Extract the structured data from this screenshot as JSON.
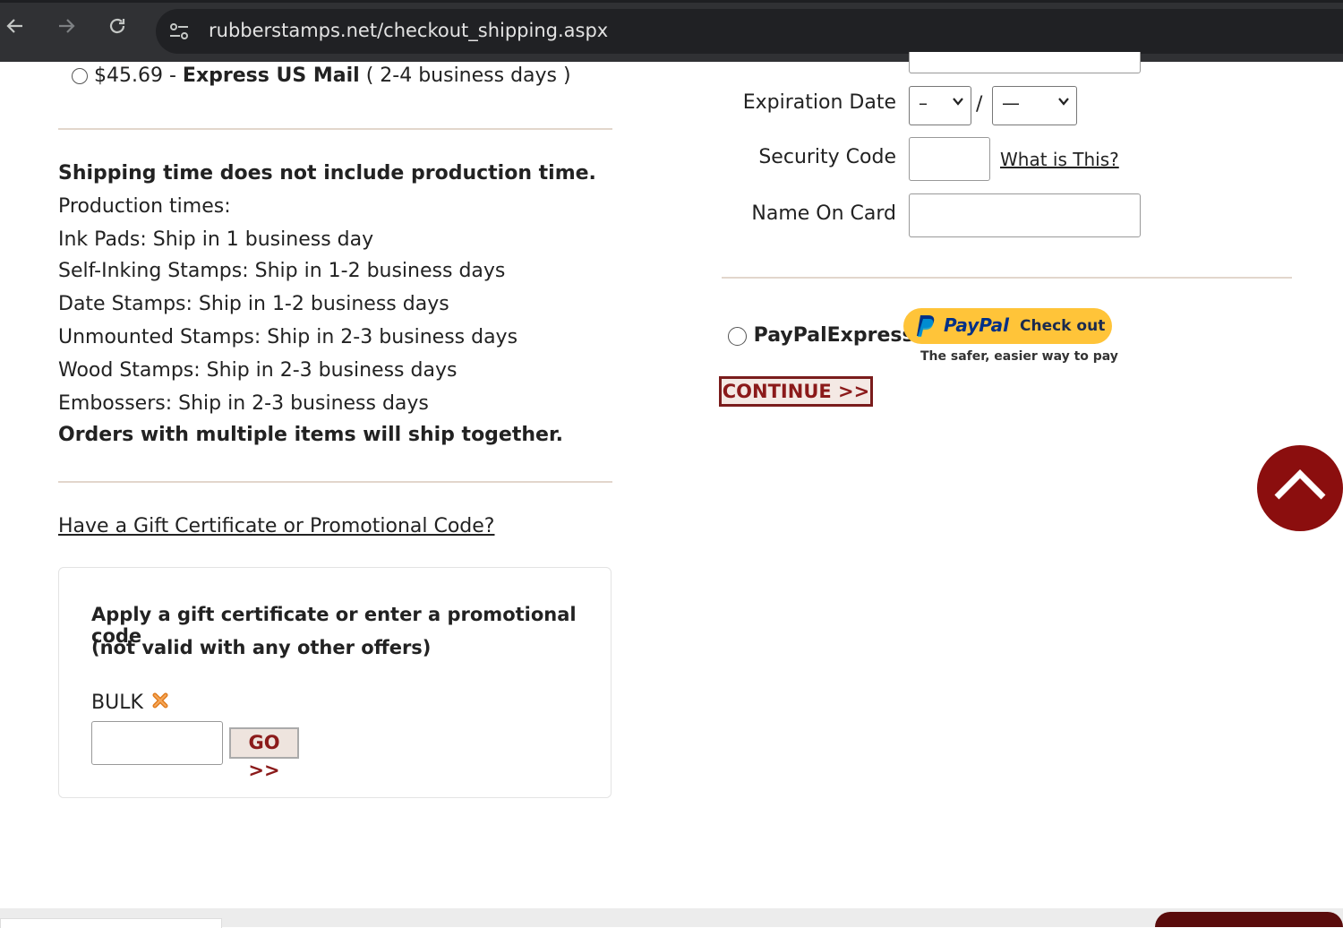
{
  "browser": {
    "url": "rubberstamps.net/checkout_shipping.aspx"
  },
  "shipping": {
    "express_option": {
      "price": "$45.69",
      "separator": " - ",
      "method": "Express US Mail",
      "days": " ( 2-4 business days )"
    },
    "notice_bold": "Shipping time does not include production time.",
    "production_header": "Production times:",
    "production_times": [
      "Ink Pads: Ship in 1 business day",
      "Self-Inking Stamps: Ship in 1-2 business days",
      "Date Stamps: Ship in 1-2 business days",
      "Unmounted Stamps: Ship in 2-3 business days",
      "Wood Stamps: Ship in 2-3 business days",
      "Embossers: Ship in 2-3 business days"
    ],
    "multiple_items_note": "Orders with multiple items will ship together."
  },
  "promo": {
    "link_text": "Have a Gift Certificate or Promotional Code?",
    "instructions_line1": "Apply a gift certificate or enter a promotional code",
    "instructions_line2": "(not valid with any other offers)",
    "applied_code": "BULK",
    "input_value": "",
    "go_label": "GO >>"
  },
  "payment": {
    "expiration_label": "Expiration Date",
    "month_value": "–",
    "slash": "/",
    "year_value": "—",
    "security_label": "Security Code",
    "security_value": "",
    "what_is_this": "What is This?",
    "name_label": "Name On Card",
    "name_value": "",
    "paypal_option": "PayPalExpress",
    "paypal_brand": "PayPal",
    "paypal_checkout": "Check out",
    "paypal_tagline": "The safer, easier way to pay",
    "continue_label": "CONTINUE >>"
  },
  "colors": {
    "accent": "#8b0e0e",
    "paypal_yellow": "#ffc439",
    "paypal_blue": "#003087",
    "paypal_light_blue": "#009cde",
    "remove_icon": "#e07b1c"
  }
}
